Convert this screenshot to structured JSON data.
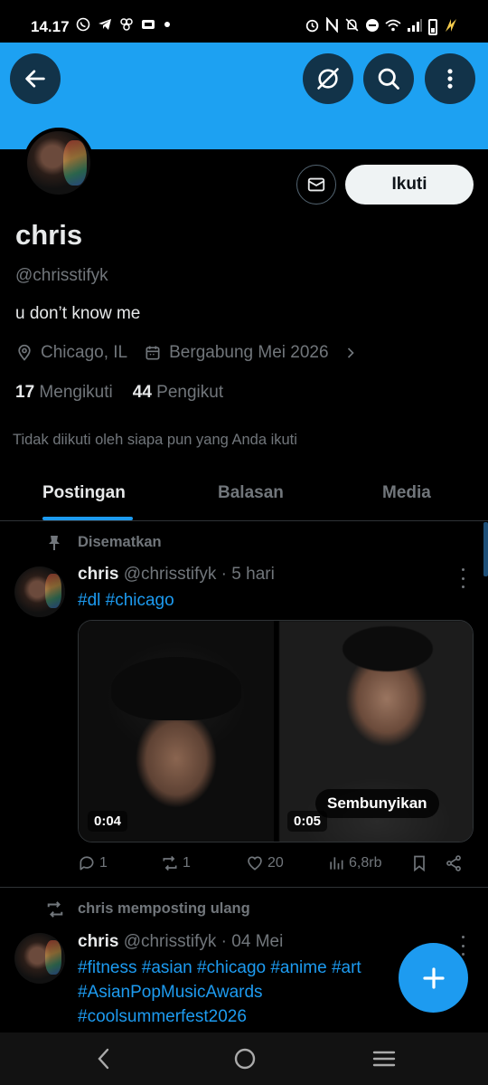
{
  "status_bar": {
    "time": "14.17",
    "left_icons": [
      "whatsapp-icon",
      "telegram-icon",
      "pinwheel-icon",
      "media-icon",
      "dot-icon"
    ],
    "right_icons": [
      "alarm-icon",
      "nfc-icon",
      "mute-icon",
      "dnd-icon",
      "wifi-icon",
      "signal-icon",
      "battery-icon"
    ]
  },
  "banner": {
    "color": "#1da1f2",
    "back_icon": "back-arrow-icon",
    "grok_icon": "grok-icon",
    "search_icon": "search-icon",
    "more_icon": "more-vertical-icon"
  },
  "profile": {
    "name": "chris",
    "handle": "@chrisstifyk",
    "bio": "u don’t know me",
    "location": "Chicago, IL",
    "joined": "Bergabung Mei 2026",
    "following_count": "17",
    "following_label": "Mengikuti",
    "followers_count": "44",
    "followers_label": "Pengikut",
    "not_followed_text": "Tidak diikuti oleh siapa pun yang Anda ikuti",
    "follow_label": "Ikuti",
    "message_icon": "envelope-icon"
  },
  "tabs": [
    {
      "label": "Postingan",
      "active": true
    },
    {
      "label": "Balasan",
      "active": false
    },
    {
      "label": "Media",
      "active": false
    }
  ],
  "posts": [
    {
      "context_label": "Disematkan",
      "context_icon": "pin-icon",
      "author": "chris",
      "handle": "@chrisstifyk",
      "time": "· 5 hari",
      "hashtags": "#dl #chicago",
      "media": [
        {
          "duration": "0:04"
        },
        {
          "duration": "0:05",
          "overlay": "Sembunyikan"
        }
      ],
      "replies": "1",
      "reposts": "1",
      "likes": "20",
      "views": "6,8rb"
    },
    {
      "context_label": "chris memposting ulang",
      "context_icon": "repost-icon",
      "author": "chris",
      "handle": "@chrisstifyk",
      "time": "· 04 Mei",
      "hashtags_line1": "#fitness #asian #chicago #anime #art",
      "hashtags_line2": "#AsianPopMusicAwards",
      "hashtags_line3": "#coolsummerfest2026"
    }
  ],
  "fab_icon": "plus-icon",
  "nav_bar": [
    "back-nav-icon",
    "home-nav-icon",
    "recents-nav-icon"
  ],
  "colors": {
    "accent": "#1d9bf0",
    "background": "#000000",
    "secondary_text": "#71767b"
  }
}
